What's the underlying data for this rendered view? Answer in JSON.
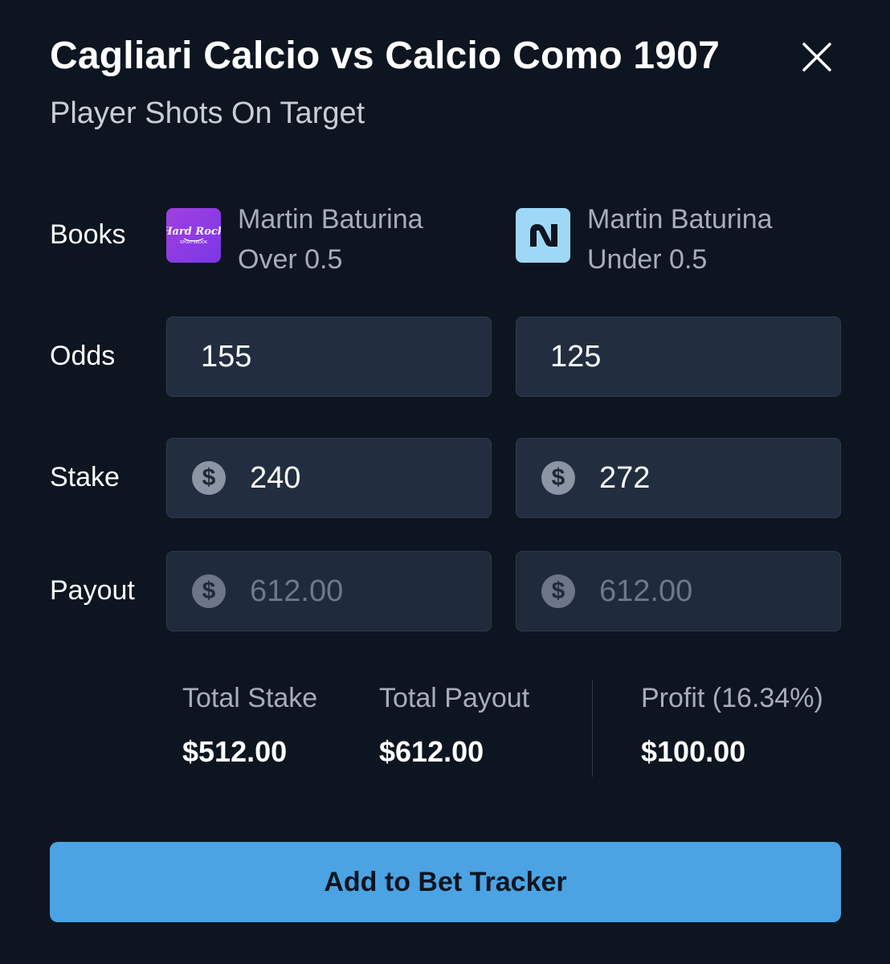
{
  "header": {
    "title": "Cagliari Calcio vs Calcio Como 1907",
    "subtitle": "Player Shots On Target",
    "close_icon": "close-icon"
  },
  "labels": {
    "books": "Books",
    "odds": "Odds",
    "stake": "Stake",
    "payout": "Payout"
  },
  "books": [
    {
      "logo": "hard-rock-sportsbook-logo",
      "logo_text_main": "Hard Rock",
      "logo_text_sub": "SPORTSBOOK",
      "logo_color": "#9b3ee2",
      "player": "Martin Baturina",
      "line": "Over 0.5"
    },
    {
      "logo": "novig-logo",
      "logo_color": "#9fd8f7",
      "player": "Martin Baturina",
      "line": "Under 0.5"
    }
  ],
  "odds": [
    "155",
    "125"
  ],
  "stake": {
    "currency_icon": "dollar-icon",
    "values": [
      "240",
      "272"
    ]
  },
  "payout": {
    "currency_icon": "dollar-icon",
    "values": [
      "612.00",
      "612.00"
    ]
  },
  "summary": {
    "total_stake_label": "Total Stake",
    "total_stake_value": "$512.00",
    "total_payout_label": "Total Payout",
    "total_payout_value": "$612.00",
    "profit_label": "Profit (16.34%)",
    "profit_value": "$100.00"
  },
  "cta": {
    "label": "Add to Bet Tracker",
    "color": "#4ba3e3"
  },
  "colors": {
    "background": "#0d1520",
    "field": "#222e40",
    "muted_text": "#a6aeba"
  }
}
